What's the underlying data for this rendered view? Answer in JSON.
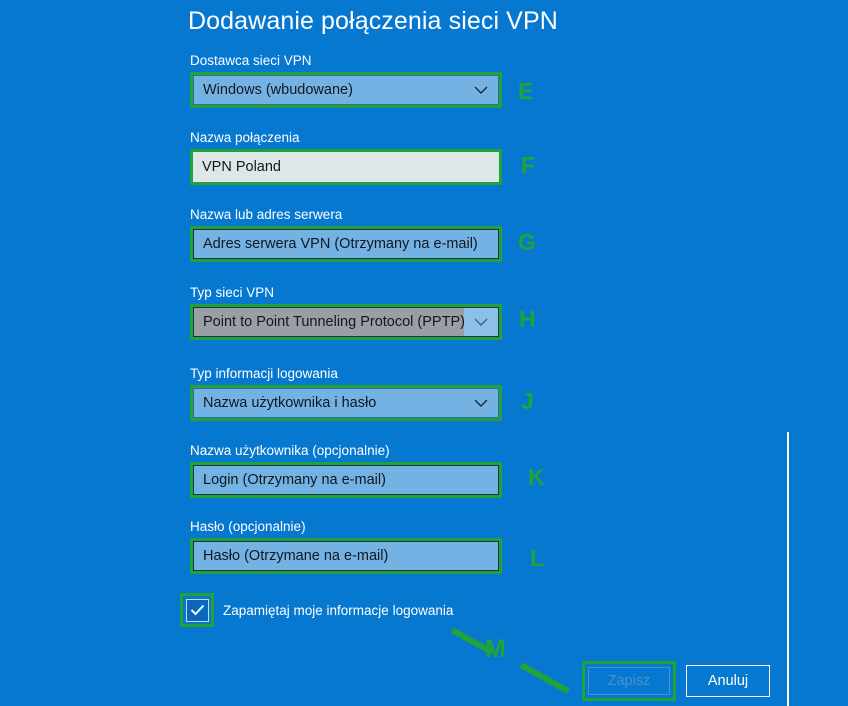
{
  "dialog": {
    "title": "Dodawanie połączenia sieci VPN"
  },
  "fields": [
    {
      "key": "provider",
      "label": "Dostawca sieci VPN",
      "value": "Windows (wbudowane)",
      "annotation": "E"
    },
    {
      "key": "connection_name",
      "label": "Nazwa połączenia",
      "value": "VPN Poland",
      "annotation": "F"
    },
    {
      "key": "server_address",
      "label": "Nazwa lub adres serwera",
      "value": "Adres serwera VPN (Otrzymany na e-mail)",
      "annotation": "G"
    },
    {
      "key": "vpn_type",
      "label": "Typ sieci VPN",
      "value": "Point to Point Tunneling Protocol (PPTP)",
      "annotation": "H"
    },
    {
      "key": "signin_type",
      "label": "Typ informacji logowania",
      "value": "Nazwa użytkownika i hasło",
      "annotation": "J"
    },
    {
      "key": "username",
      "label": "Nazwa użytkownika (opcjonalnie)",
      "value": "Login (Otrzymany na e-mail)",
      "annotation": "K"
    },
    {
      "key": "password",
      "label": "Hasło (opcjonalnie)",
      "value": "Hasło (Otrzymane na e-mail)",
      "annotation": "L"
    }
  ],
  "checkbox": {
    "label": "Zapamiętaj moje informacje logowania",
    "checked": true,
    "annotation": "M"
  },
  "buttons": {
    "save": "Zapisz",
    "cancel": "Anuluj"
  },
  "colors": {
    "background": "#0778d0",
    "annotation_green": "#22a33a",
    "input_fill": "#74b2e4",
    "input_fill_light": "#dfe6ea",
    "combo_active_fill": "#9a9fa5",
    "text_white": "#ffffff",
    "text_dark": "#101820",
    "save_disabled": "#4d8fc9"
  },
  "icons": {
    "chevron": "chevron-down-icon",
    "check": "check-icon"
  }
}
